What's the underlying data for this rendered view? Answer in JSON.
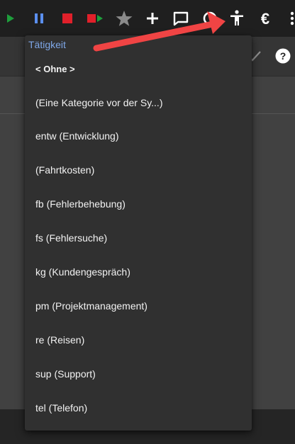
{
  "menu": {
    "header": "Tätigkeit",
    "items": [
      {
        "label": "< Ohne >",
        "bold": true
      },
      {
        "label": " (Eine Kategorie vor der Sy...)"
      },
      {
        "label": "entw (Entwicklung)"
      },
      {
        "label": " (Fahrtkosten)"
      },
      {
        "label": "fb (Fehlerbehebung)"
      },
      {
        "label": "fs (Fehlersuche)"
      },
      {
        "label": "kg (Kundengespräch)"
      },
      {
        "label": "pm (Projektmanagement)"
      },
      {
        "label": "re (Reisen)"
      },
      {
        "label": "sup (Support)"
      },
      {
        "label": "tel (Telefon)"
      }
    ]
  },
  "toolbar": {
    "buttons": [
      {
        "icon": "play-record-icon",
        "color": "#1e9e3c"
      },
      {
        "icon": "pause-icon",
        "color": "#5b8ff0"
      },
      {
        "icon": "stop-icon",
        "color": "#e0202a"
      },
      {
        "icon": "stop-and-play-icon",
        "color": "#e0202a"
      },
      {
        "icon": "star-icon",
        "color": "#8a8a8a"
      },
      {
        "icon": "plus-icon",
        "color": "#ffffff"
      },
      {
        "icon": "comment-icon",
        "color": "#ffffff"
      },
      {
        "icon": "timer-icon",
        "color": "#ffffff"
      },
      {
        "icon": "accessibility-icon",
        "color": "#ffffff"
      },
      {
        "icon": "euro-icon",
        "color": "#ffffff"
      },
      {
        "icon": "more-vert-icon",
        "color": "#ffffff"
      }
    ],
    "euro_symbol": "€"
  },
  "subbar": {
    "help_symbol": "?"
  },
  "annotation": {
    "arrow_color": "#f04444"
  }
}
